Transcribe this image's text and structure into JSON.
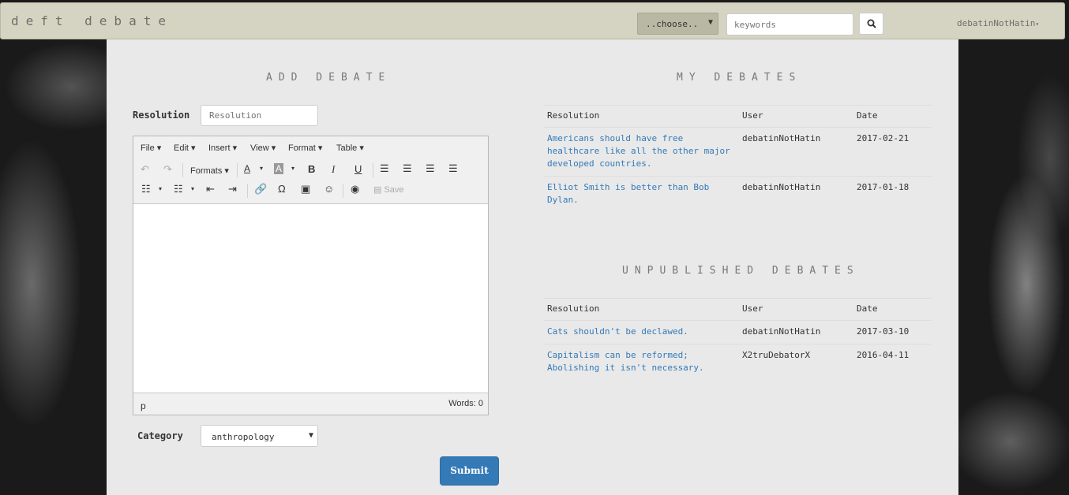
{
  "navbar": {
    "brand": "deft debate",
    "category_select": "..choose..",
    "keywords_placeholder": "keywords",
    "user": "debatinNotHatin"
  },
  "add_debate": {
    "title": "ADD DEBATE",
    "resolution_label": "Resolution",
    "resolution_placeholder": "Resolution",
    "editor": {
      "menus": [
        "File",
        "Edit",
        "Insert",
        "View",
        "Format",
        "Table"
      ],
      "formats_label": "Formats",
      "save_label": "Save",
      "status_path": "p",
      "word_count": "Words: 0"
    },
    "category_label": "Category",
    "category_value": "anthropology",
    "submit_label": "Submit"
  },
  "my_debates": {
    "title": "MY DEBATES",
    "headers": [
      "Resolution",
      "User",
      "Date"
    ],
    "rows": [
      {
        "resolution": "Americans should have free healthcare like all the other major developed countries.",
        "user": "debatinNotHatin",
        "date": "2017-02-21"
      },
      {
        "resolution": "Elliot Smith is better than Bob Dylan.",
        "user": "debatinNotHatin",
        "date": "2017-01-18"
      }
    ]
  },
  "unpublished_debates": {
    "title": "UNPUBLISHED DEBATES",
    "headers": [
      "Resolution",
      "User",
      "Date"
    ],
    "rows": [
      {
        "resolution": "Cats shouldn't be declawed.",
        "user": "debatinNotHatin",
        "date": "2017-03-10"
      },
      {
        "resolution": "Capitalism can be reformed; Abolishing it isn't necessary.",
        "user": "X2truDebatorX",
        "date": "2016-04-11"
      }
    ]
  },
  "colors": {
    "navbar": "#d5d4c3",
    "panel": "#e9e9e9",
    "link": "#337ab7",
    "submit": "#337ab7"
  }
}
